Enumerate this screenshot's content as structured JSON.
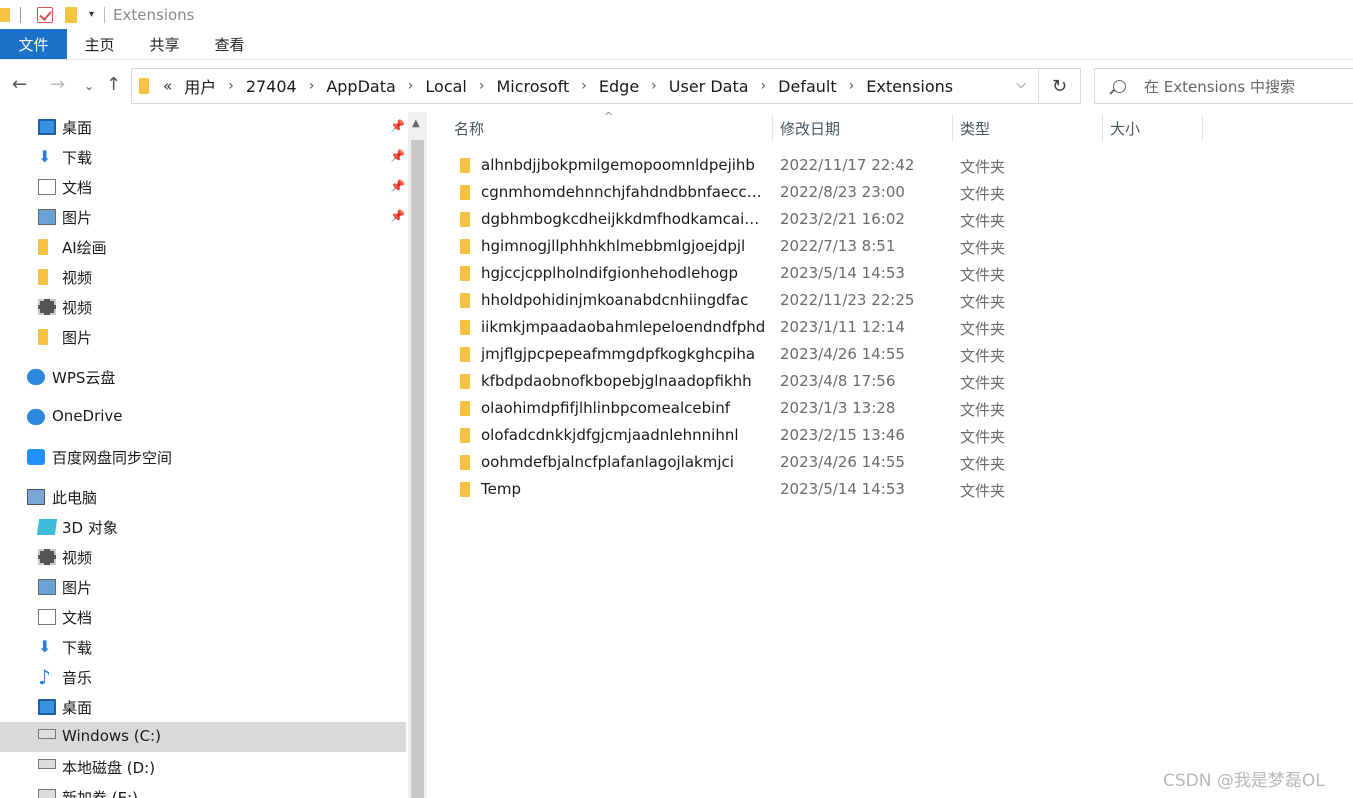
{
  "title": "Extensions",
  "ribbon": {
    "file": "文件",
    "home": "主页",
    "share": "共享",
    "view": "查看"
  },
  "address": {
    "overflow": "«",
    "crumbs": [
      "用户",
      "27404",
      "AppData",
      "Local",
      "Microsoft",
      "Edge",
      "User Data",
      "Default",
      "Extensions"
    ]
  },
  "search": {
    "placeholder": "在 Extensions 中搜索"
  },
  "sidebar": {
    "items": [
      {
        "label": "桌面",
        "icon": "desktop-icon",
        "pinned": true
      },
      {
        "label": "下载",
        "icon": "download-icon",
        "pinned": true
      },
      {
        "label": "文档",
        "icon": "document-icon",
        "pinned": true
      },
      {
        "label": "图片",
        "icon": "pictures-icon",
        "pinned": true
      },
      {
        "label": "AI绘画",
        "icon": "folder-icon"
      },
      {
        "label": "视频",
        "icon": "folder-icon"
      },
      {
        "label": "视频",
        "icon": "video-icon"
      },
      {
        "label": "图片",
        "icon": "folder-icon"
      },
      {
        "label": "WPS云盘",
        "icon": "cloud-icon"
      },
      {
        "label": "OneDrive",
        "icon": "onedrive-icon"
      },
      {
        "label": "百度网盘同步空间",
        "icon": "baidu-netdisk-icon"
      },
      {
        "label": "此电脑",
        "icon": "computer-icon"
      },
      {
        "label": "3D 对象",
        "icon": "3d-objects-icon"
      },
      {
        "label": "视频",
        "icon": "video-icon"
      },
      {
        "label": "图片",
        "icon": "pictures-icon"
      },
      {
        "label": "文档",
        "icon": "document-icon"
      },
      {
        "label": "下载",
        "icon": "download-icon"
      },
      {
        "label": "音乐",
        "icon": "music-icon"
      },
      {
        "label": "桌面",
        "icon": "desktop-icon"
      },
      {
        "label": "Windows (C:)",
        "icon": "drive-icon",
        "selected": true
      },
      {
        "label": "本地磁盘 (D:)",
        "icon": "drive-icon"
      },
      {
        "label": "新加卷 (E:)",
        "icon": "drive-icon"
      }
    ]
  },
  "columns": {
    "name": "名称",
    "date": "修改日期",
    "type": "类型",
    "size": "大小"
  },
  "files": [
    {
      "name": "alhnbdjjbokpmilgemopoomnldpejihb",
      "date": "2022/11/17 22:42",
      "type": "文件夹"
    },
    {
      "name": "cgnmhomdehnnchjfahdndbbnfaeccg...",
      "date": "2022/8/23 23:00",
      "type": "文件夹"
    },
    {
      "name": "dgbhmbogkcdheijkkdmfhodkamcaih...",
      "date": "2023/2/21 16:02",
      "type": "文件夹"
    },
    {
      "name": "hgimnogjllphhhkhlmebbmlgjoejdpjl",
      "date": "2022/7/13 8:51",
      "type": "文件夹"
    },
    {
      "name": "hgjccjcpplholndifgionhehodlehogp",
      "date": "2023/5/14 14:53",
      "type": "文件夹"
    },
    {
      "name": "hholdpohidinjmkoanabdcnhiingdfac",
      "date": "2022/11/23 22:25",
      "type": "文件夹"
    },
    {
      "name": "iikmkjmpaadaobahmlepeloendndfphd",
      "date": "2023/1/11 12:14",
      "type": "文件夹"
    },
    {
      "name": "jmjflgjpcpepeafmmgdpfkogkghcpiha",
      "date": "2023/4/26 14:55",
      "type": "文件夹"
    },
    {
      "name": "kfbdpdaobnofkbopebjglnaadopfikhh",
      "date": "2023/4/8 17:56",
      "type": "文件夹"
    },
    {
      "name": "olaohimdpfifjlhlinbpcomealcebinf",
      "date": "2023/1/3 13:28",
      "type": "文件夹"
    },
    {
      "name": "olofadcdnkkjdfgjcmjaadnlehnnihnl",
      "date": "2023/2/15 13:46",
      "type": "文件夹"
    },
    {
      "name": "oohmdefbjalncfplafanlagojlakmjci",
      "date": "2023/4/26 14:55",
      "type": "文件夹"
    },
    {
      "name": "Temp",
      "date": "2023/5/14 14:53",
      "type": "文件夹"
    }
  ],
  "watermark": "CSDN @我是梦磊OL"
}
